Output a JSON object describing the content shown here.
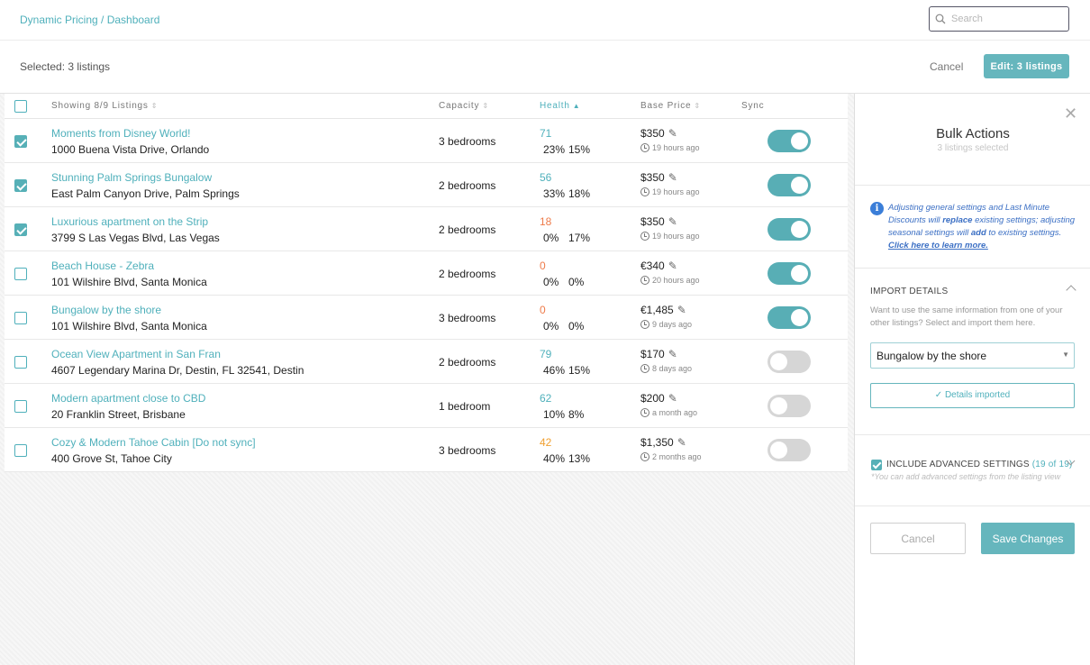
{
  "header": {
    "breadcrumb": "Dynamic Pricing / Dashboard",
    "search_placeholder": "Search"
  },
  "selection_bar": {
    "selected_text": "Selected: 3 listings",
    "cancel_label": "Cancel",
    "edit_label": "Edit: 3 listings"
  },
  "table": {
    "columns": {
      "listings": "Showing 8/9 Listings",
      "capacity": "Capacity",
      "health": "Health",
      "base_price": "Base Price",
      "sync": "Sync"
    },
    "rows": [
      {
        "checked": true,
        "name": "Moments from Disney World!",
        "address": "1000 Buena Vista Drive, Orlando",
        "capacity": "3 bedrooms",
        "health": "71",
        "health_color": "#4fb0bb",
        "pct1": "23%",
        "pct2": "15%",
        "price": "$350",
        "updated": "19 hours ago",
        "sync": true
      },
      {
        "checked": true,
        "name": "Stunning Palm Springs Bungalow",
        "address": "East Palm Canyon Drive, Palm Springs",
        "capacity": "2 bedrooms",
        "health": "56",
        "health_color": "#4fb0bb",
        "pct1": "33%",
        "pct2": "18%",
        "price": "$350",
        "updated": "19 hours ago",
        "sync": true
      },
      {
        "checked": true,
        "name": "Luxurious apartment on the Strip",
        "address": "3799 S Las Vegas Blvd, Las Vegas",
        "capacity": "2 bedrooms",
        "health": "18",
        "health_color": "#ee7b4a",
        "pct1": "0%",
        "pct2": "17%",
        "price": "$350",
        "updated": "19 hours ago",
        "sync": true
      },
      {
        "checked": false,
        "name": "Beach House - Zebra",
        "address": "101 Wilshire Blvd, Santa Monica",
        "capacity": "2 bedrooms",
        "health": "0",
        "health_color": "#ee7b4a",
        "pct1": "0%",
        "pct2": "0%",
        "price": "€340",
        "updated": "20 hours ago",
        "sync": true
      },
      {
        "checked": false,
        "name": "Bungalow by the shore",
        "address": "101 Wilshire Blvd, Santa Monica",
        "capacity": "3 bedrooms",
        "health": "0",
        "health_color": "#ee7b4a",
        "pct1": "0%",
        "pct2": "0%",
        "price": "€1,485",
        "updated": "9 days ago",
        "sync": true
      },
      {
        "checked": false,
        "name": "Ocean View Apartment in San Fran",
        "address": "4607 Legendary Marina Dr, Destin, FL 32541, Destin",
        "capacity": "2 bedrooms",
        "health": "79",
        "health_color": "#4fb0bb",
        "pct1": "46%",
        "pct2": "15%",
        "price": "$170",
        "updated": "8 days ago",
        "sync": false
      },
      {
        "checked": false,
        "name": "Modern apartment close to CBD",
        "address": "20 Franklin Street, Brisbane",
        "capacity": "1 bedroom",
        "health": "62",
        "health_color": "#4fb0bb",
        "pct1": "10%",
        "pct2": "8%",
        "price": "$200",
        "updated": "a month ago",
        "sync": false
      },
      {
        "checked": false,
        "name": "Cozy & Modern Tahoe Cabin [Do not sync]",
        "address": "400 Grove St, Tahoe City",
        "capacity": "3 bedrooms",
        "health": "42",
        "health_color": "#f0a030",
        "pct1": "40%",
        "pct2": "13%",
        "price": "$1,350",
        "updated": "2 months ago",
        "sync": false
      }
    ]
  },
  "panel": {
    "title": "Bulk Actions",
    "subtitle": "3 listings selected",
    "info_1": "Adjusting general settings and Last Minute Discounts will ",
    "info_replace": "replace",
    "info_2": " existing settings; adjusting seasonal settings will ",
    "info_add": "add",
    "info_3": " to existing settings. ",
    "info_link": "Click here to learn more.",
    "import_heading": "IMPORT DETAILS",
    "import_desc": "Want to use the same information from one of your other listings? Select and import them here.",
    "import_selected": "Bungalow by the shore",
    "import_status": "✓ Details imported",
    "advanced_label": "INCLUDE ADVANCED SETTINGS",
    "advanced_count": "(19 of 19)",
    "advanced_note": "*You can add advanced settings from the listing view",
    "cancel_label": "Cancel",
    "save_label": "Save Changes"
  },
  "colors": {
    "accent": "#66b6bd",
    "link": "#4fb0bb",
    "warning": "#ee7b4a",
    "info": "#3b7ed8"
  }
}
